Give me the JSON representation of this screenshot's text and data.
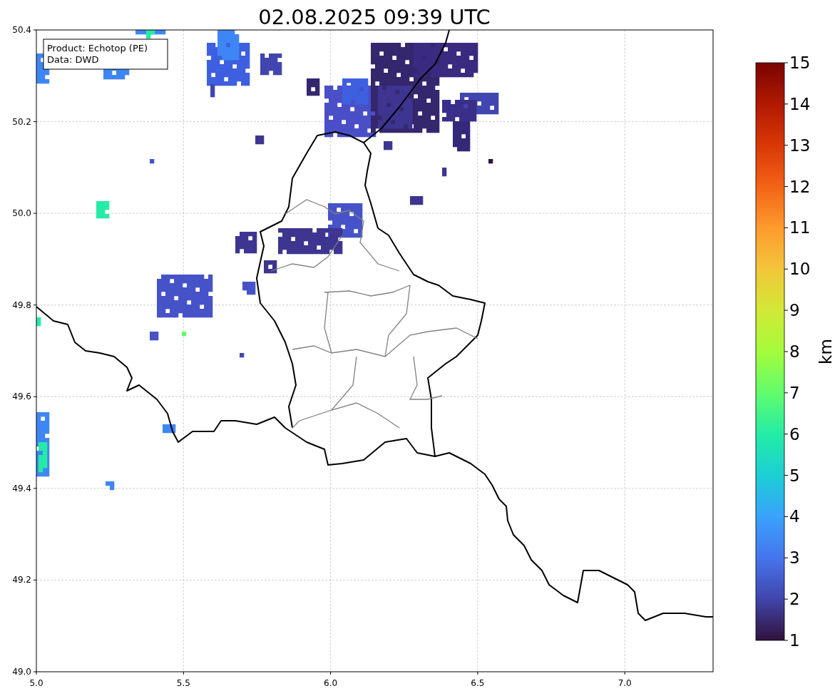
{
  "title": "02.08.2025 09:39 UTC",
  "info_box": [
    "Product: Echotop (PE)",
    "Data: DWD"
  ],
  "map": {
    "xticks": [
      "5.0",
      "5.5",
      "6.0",
      "6.5",
      "7.0"
    ],
    "yticks": [
      "50.4",
      "50.2",
      "50.0",
      "49.8",
      "49.6",
      "49.4",
      "49.2",
      "49.0"
    ]
  },
  "colorbar": {
    "label": "km",
    "ticks": [
      "15",
      "14",
      "13",
      "12",
      "11",
      "10",
      "9",
      "8",
      "7",
      "6",
      "5",
      "4",
      "3",
      "2",
      "1"
    ]
  }
}
